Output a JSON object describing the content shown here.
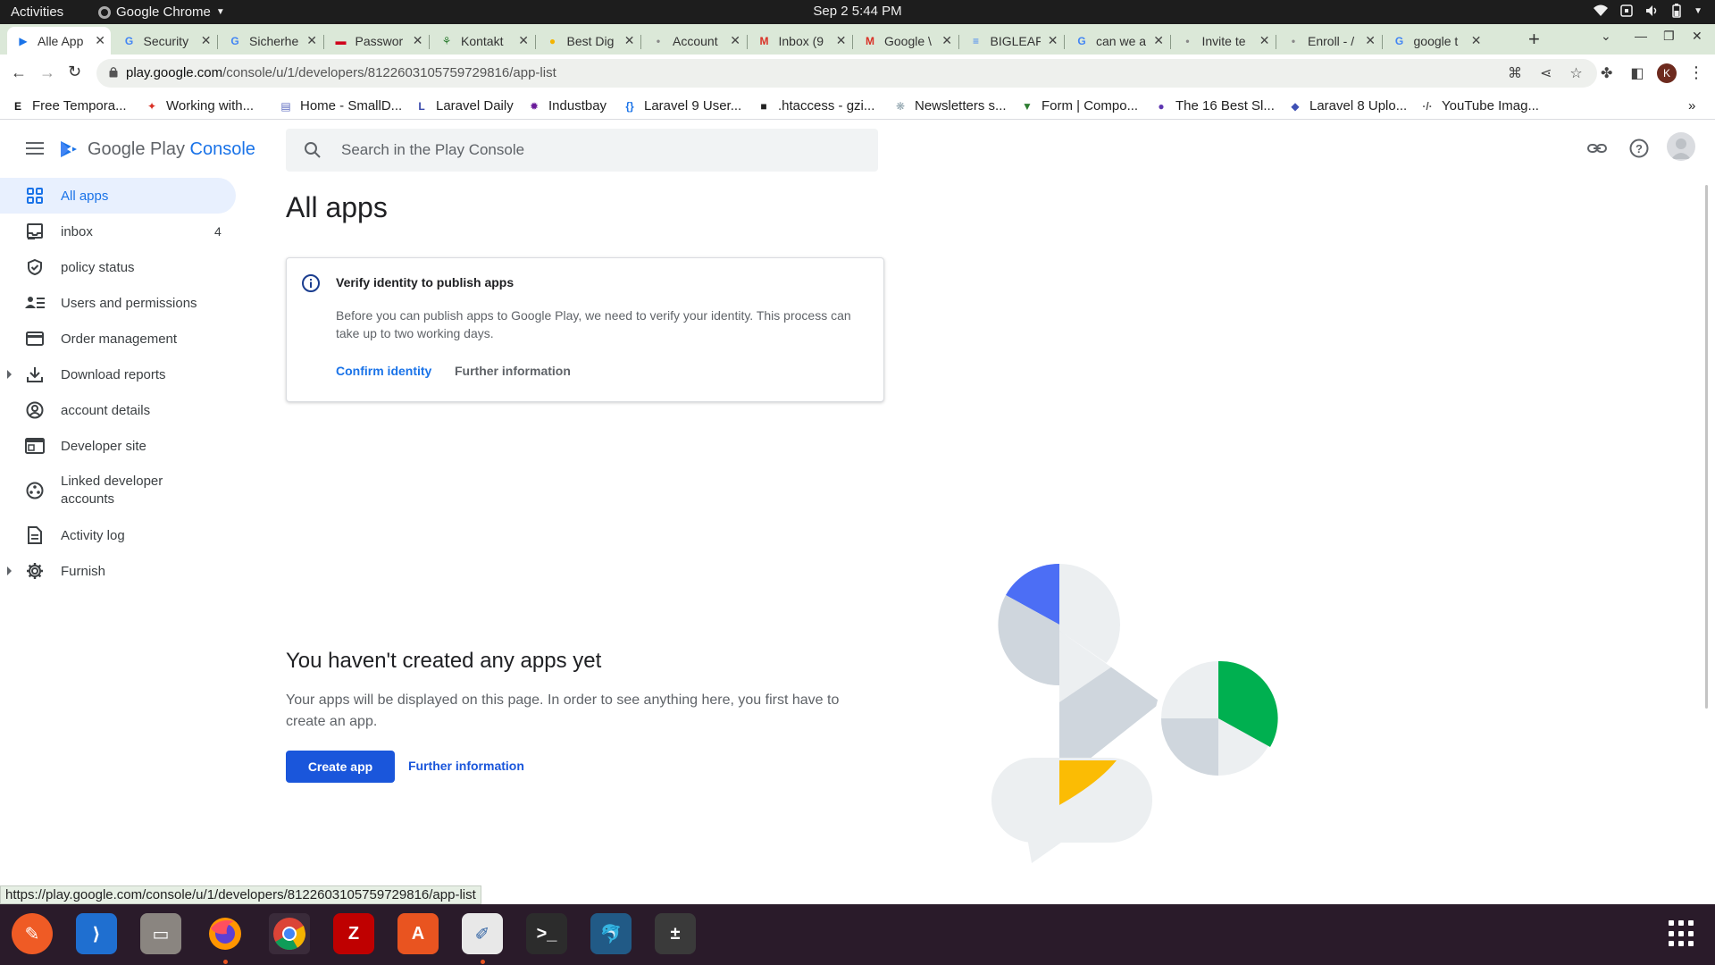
{
  "system": {
    "activities": "Activities",
    "app_name": "Google Chrome",
    "clock": "Sep 2  5:44 PM"
  },
  "browser": {
    "tabs": [
      {
        "title": "Alle App",
        "icon": "play-console-favicon",
        "active": true
      },
      {
        "title": "Security",
        "icon": "google-favicon"
      },
      {
        "title": "Sicherhe",
        "icon": "google-favicon"
      },
      {
        "title": "Passwor",
        "icon": "red-favicon"
      },
      {
        "title": "Kontakt",
        "icon": "tree-favicon"
      },
      {
        "title": "Best Dig",
        "icon": "coin-favicon"
      },
      {
        "title": "Account",
        "icon": "apple-favicon"
      },
      {
        "title": "Inbox (9",
        "icon": "gmail-favicon"
      },
      {
        "title": "Google \\",
        "icon": "gmail-favicon"
      },
      {
        "title": "BIGLEAF",
        "icon": "docs-favicon"
      },
      {
        "title": "can we a",
        "icon": "google-favicon"
      },
      {
        "title": "Invite te",
        "icon": "apple-favicon"
      },
      {
        "title": "Enroll - /",
        "icon": "apple-favicon"
      },
      {
        "title": "google t",
        "icon": "google-favicon"
      }
    ],
    "url_prefix": "play.google.com",
    "url_path": "/console/u/1/developers/8122603105759729816/app-list",
    "profile_initial": "K",
    "bookmarks": [
      {
        "label": "Free Tempora...",
        "icon": "E"
      },
      {
        "label": "Working with...",
        "icon": "✦"
      },
      {
        "label": "Home - SmallD...",
        "icon": "▤"
      },
      {
        "label": "Laravel Daily",
        "icon": "L"
      },
      {
        "label": "Industbay",
        "icon": "✹"
      },
      {
        "label": "Laravel 9 User...",
        "icon": "{}"
      },
      {
        "label": ".htaccess - gzi...",
        "icon": "■"
      },
      {
        "label": "Newsletters s...",
        "icon": "❋"
      },
      {
        "label": "Form | Compo...",
        "icon": "▼"
      },
      {
        "label": "The 16 Best Sl...",
        "icon": "●"
      },
      {
        "label": "Laravel 8 Uplo...",
        "icon": "◆"
      },
      {
        "label": "YouTube Imag...",
        "icon": "·/·"
      }
    ],
    "status_url": "https://play.google.com/console/u/1/developers/8122603105759729816/app-list"
  },
  "console": {
    "logo_text_a": "Google Play ",
    "logo_text_b": "Console",
    "search_placeholder": "Search in the Play Console"
  },
  "sidebar": {
    "items": [
      {
        "label": "All apps",
        "icon": "grid-icon",
        "active": true
      },
      {
        "label": "inbox",
        "icon": "inbox-icon",
        "count": "4"
      },
      {
        "label": "policy status",
        "icon": "shield-check-icon"
      },
      {
        "label": "Users and permissions",
        "icon": "people-list-icon"
      },
      {
        "label": "Order management",
        "icon": "credit-card-icon"
      },
      {
        "label": "Download reports",
        "icon": "download-icon",
        "expandable": true
      },
      {
        "label": "account details",
        "icon": "account-circle-icon"
      },
      {
        "label": "Developer site",
        "icon": "web-window-icon"
      },
      {
        "label": "Linked developer accounts",
        "icon": "linked-accounts-icon"
      },
      {
        "label": "Activity log",
        "icon": "document-icon"
      },
      {
        "label": "Furnish",
        "icon": "gear-icon",
        "expandable": true
      }
    ]
  },
  "main": {
    "title": "All apps",
    "notice": {
      "title": "Verify identity to publish apps",
      "body": "Before you can publish apps to Google Play, we need to verify your identity. This process can take up to two working days.",
      "primary_link": "Confirm identity",
      "secondary_link": "Further information"
    },
    "empty_state": {
      "title": "You haven't created any apps yet",
      "body": "Your apps will be displayed on this page. In order to see anything here, you first have to create an app.",
      "button": "Create app",
      "link": "Further information"
    }
  },
  "colors": {
    "accent": "#1a73e8",
    "button": "#1a56db",
    "active_nav_bg": "#e8f0fe",
    "illus_blue": "#4c6ef5",
    "illus_green": "#00b050",
    "illus_yellow": "#fbbc04",
    "illus_grey": "#cfd6dd"
  },
  "dock": {
    "apps": [
      {
        "name": "postman-icon",
        "color": "#ef5b25"
      },
      {
        "name": "vscode-icon",
        "color": "#1f6fd0"
      },
      {
        "name": "files-icon",
        "color": "#8a8580"
      },
      {
        "name": "firefox-icon",
        "color": "#e66000"
      },
      {
        "name": "chrome-icon",
        "color": "#4285f4"
      },
      {
        "name": "filezilla-icon",
        "color": "#bf0000"
      },
      {
        "name": "app-center-icon",
        "color": "#e95420"
      },
      {
        "name": "text-editor-icon",
        "color": "#e8e8e8"
      },
      {
        "name": "terminal-icon",
        "color": "#2c2c2c"
      },
      {
        "name": "mysql-workbench-icon",
        "color": "#215a86"
      },
      {
        "name": "calculator-icon",
        "color": "#3a3a3a"
      }
    ]
  }
}
